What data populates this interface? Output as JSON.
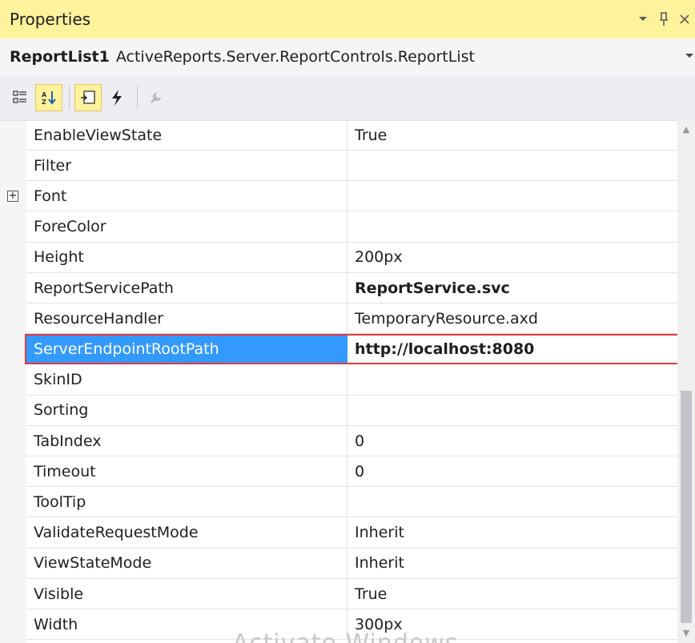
{
  "panel": {
    "title": "Properties",
    "dropdown_icon": "dropdown-arrow-icon",
    "pin_icon": "pin-icon",
    "close_icon": "close-icon"
  },
  "object_selector": {
    "name": "ReportList1",
    "type": "ActiveReports.Server.ReportControls.ReportList"
  },
  "toolbar": {
    "buttons": [
      "categorized-icon",
      "alphabetical-icon",
      "properties-icon",
      "events-icon",
      "property-pages-icon"
    ],
    "active": [
      "alphabetical-icon",
      "properties-icon"
    ]
  },
  "properties": [
    {
      "name": "EnableViewState",
      "value": "True"
    },
    {
      "name": "Filter",
      "value": ""
    },
    {
      "name": "Font",
      "value": "",
      "expandable": true
    },
    {
      "name": "ForeColor",
      "value": ""
    },
    {
      "name": "Height",
      "value": "200px"
    },
    {
      "name": "ReportServicePath",
      "value": "ReportService.svc",
      "bold": true
    },
    {
      "name": "ResourceHandler",
      "value": "TemporaryResource.axd"
    },
    {
      "name": "ServerEndpointRootPath",
      "value": "http://localhost:8080",
      "bold": true,
      "selected": true
    },
    {
      "name": "SkinID",
      "value": ""
    },
    {
      "name": "Sorting",
      "value": ""
    },
    {
      "name": "TabIndex",
      "value": "0"
    },
    {
      "name": "Timeout",
      "value": "0"
    },
    {
      "name": "ToolTip",
      "value": ""
    },
    {
      "name": "ValidateRequestMode",
      "value": "Inherit"
    },
    {
      "name": "ViewStateMode",
      "value": "Inherit"
    },
    {
      "name": "Visible",
      "value": "True"
    },
    {
      "name": "Width",
      "value": "300px"
    }
  ],
  "colors": {
    "title_bar": "#fff29d",
    "selection": "#3399ff",
    "highlight_border": "#e0393e"
  },
  "watermark": "Activate Windows"
}
